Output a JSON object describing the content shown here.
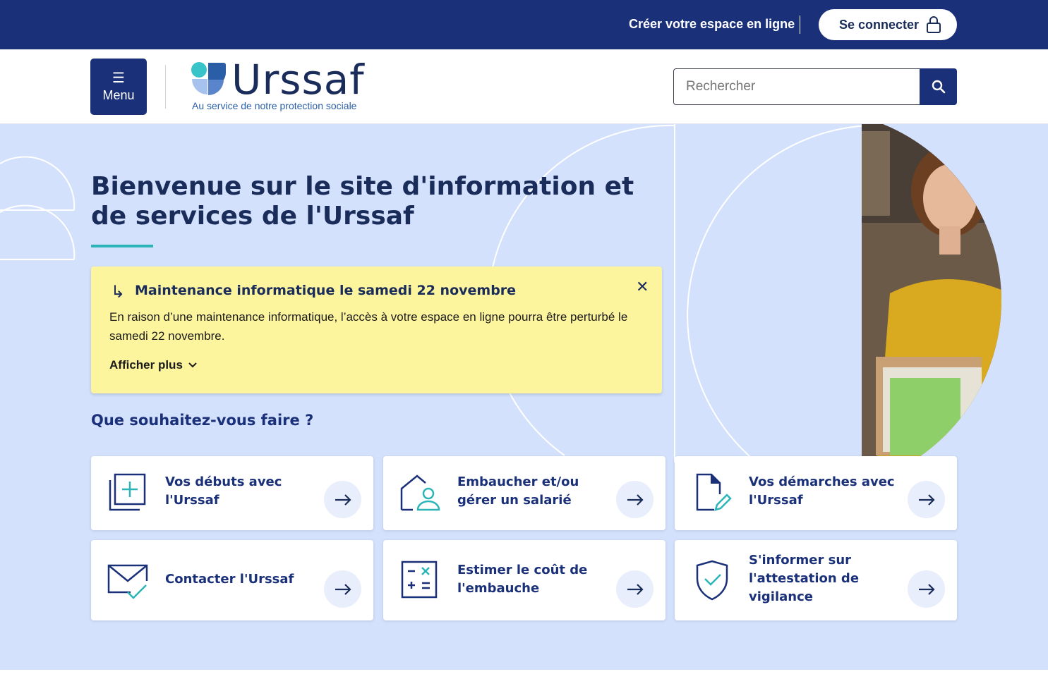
{
  "topbar": {
    "create_account": "Créer votre espace en ligne",
    "login": "Se connecter",
    "login_icon": "lock-icon"
  },
  "header": {
    "menu_label": "Menu",
    "menu_icon": "hamburger-icon",
    "logo_word": "Urssaf",
    "logo_tagline": "Au service de notre protection sociale",
    "search_placeholder": "Rechercher",
    "search_icon": "search-icon"
  },
  "hero": {
    "title": "Bienvenue sur le site d'information et de services de l'Urssaf",
    "subtitle": "Que souhaitez-vous faire ?"
  },
  "alert": {
    "title": "Maintenance informatique le samedi 22 novembre",
    "body": "En raison d’une maintenance informatique, l’accès à votre espace en ligne pourra être perturbé le samedi 22 novembre.",
    "more": "Afficher plus",
    "close_icon": "close-icon"
  },
  "cards": [
    {
      "label": "Vos débuts avec l'Urssaf",
      "icon": "add-document-icon"
    },
    {
      "label": "Embaucher et/ou gérer un salarié",
      "icon": "house-person-icon"
    },
    {
      "label": "Vos démarches avec l'Urssaf",
      "icon": "document-edit-icon"
    },
    {
      "label": "Contacter l'Urssaf",
      "icon": "mail-check-icon"
    },
    {
      "label": "Estimer le coût de l'embauche",
      "icon": "calculator-icon"
    },
    {
      "label": "S'informer sur l'attestation de vigilance",
      "icon": "shield-check-icon"
    }
  ],
  "colors": {
    "navy": "#1a3079",
    "hero_bg": "#d3e1fd",
    "alert_bg": "#fdf59e",
    "accent_teal": "#2bb5b8"
  }
}
